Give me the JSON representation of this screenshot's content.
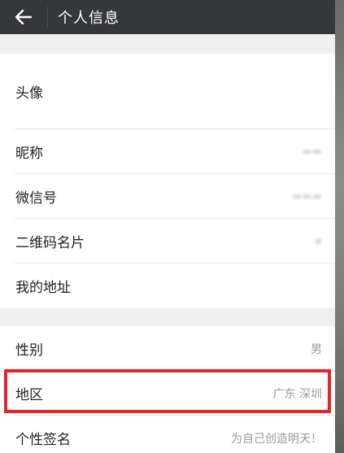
{
  "header": {
    "title": "个人信息",
    "back_icon": "arrow-left-icon"
  },
  "profile": {
    "avatar_label": "头像",
    "nickname_label": "昵称",
    "wechat_id_label": "微信号",
    "qrcode_label": "二维码名片",
    "address_label": "我的地址"
  },
  "details": {
    "gender_label": "性别",
    "gender_value": "男",
    "region_label": "地区",
    "region_value": "广东 深圳",
    "signature_label": "个性签名",
    "signature_value": "为自己创造明天！"
  },
  "colors": {
    "topbar": "#36373b",
    "highlight": "#e8232a",
    "background": "#efefef"
  }
}
